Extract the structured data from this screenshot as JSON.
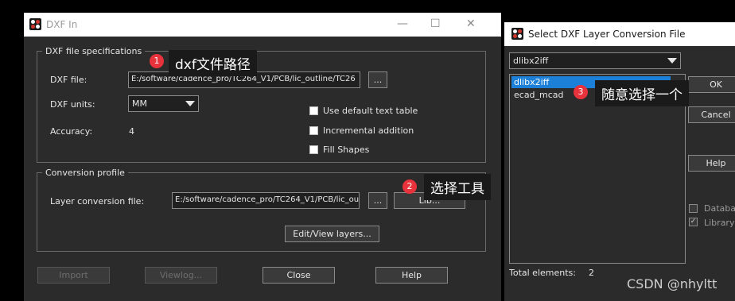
{
  "dxf_in": {
    "title": "DXF In",
    "controls": {
      "minimize": "—",
      "maximize": "☐",
      "close": "✕"
    },
    "specs": {
      "legend": "DXF file specifications",
      "dxf_file_label": "DXF file:",
      "dxf_file_value": "E:/software/cadence_pro/TC264_V1/PCB/lic_outline/TC26",
      "browse": "...",
      "units_label": "DXF units:",
      "units_value": "MM",
      "accuracy_label": "Accuracy:",
      "accuracy_value": "4",
      "use_default_text_table": "Use default text table",
      "incremental_addition": "Incremental addition",
      "fill_shapes": "Fill Shapes"
    },
    "profile": {
      "legend": "Conversion profile",
      "layer_file_label": "Layer conversion file:",
      "layer_file_value": "E:/software/cadence_pro/TC264_V1/PCB/lic_ou",
      "browse": "...",
      "lib": "Lib...",
      "edit_view": "Edit/View layers..."
    },
    "buttons": {
      "import": "Import",
      "viewlog": "Viewlog...",
      "close": "Close",
      "help": "Help"
    }
  },
  "select_dialog": {
    "title": "Select DXF Layer Conversion File",
    "dropdown_value": "dlibx2iff",
    "items": [
      "dlibx2iff",
      "ecad_mcad"
    ],
    "selected_index": 0,
    "ok": "OK",
    "cancel": "Cancel",
    "help": "Help",
    "database": "Database",
    "library": "Library",
    "total_label": "Total elements:",
    "total_value": "2"
  },
  "annotations": [
    {
      "number": "1",
      "text": "dxf文件路径"
    },
    {
      "number": "2",
      "text": "选择工具"
    },
    {
      "number": "3",
      "text": "随意选择一个"
    }
  ],
  "watermark": "CSDN @nhyltt",
  "colors": {
    "accent": "#1c7fd8",
    "badge": "#e8323c",
    "window_bg": "#2b2b2b"
  }
}
